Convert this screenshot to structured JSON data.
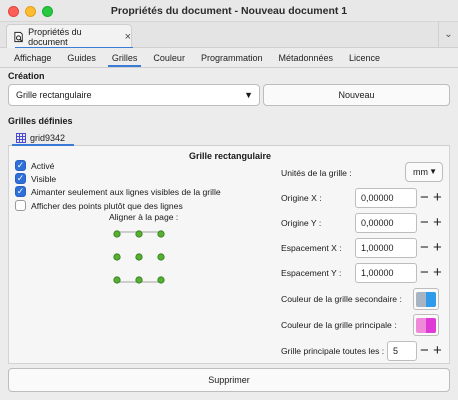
{
  "window": {
    "title": "Propriétés du document - Nouveau document 1"
  },
  "doc_tab": {
    "label": "Propriétés du document",
    "close": "×"
  },
  "tabs": [
    "Affichage",
    "Guides",
    "Grilles",
    "Couleur",
    "Programmation",
    "Métadonnées",
    "Licence"
  ],
  "active_tab": "Grilles",
  "creation": {
    "label": "Création",
    "grid_type": "Grille rectangulaire",
    "new_button": "Nouveau"
  },
  "defined": {
    "label": "Grilles définies",
    "grid_name": "grid9342"
  },
  "panel": {
    "title": "Grille rectangulaire",
    "checks": [
      {
        "label": "Activé",
        "checked": true
      },
      {
        "label": "Visible",
        "checked": true
      },
      {
        "label": "Aimanter seulement aux lignes visibles de la grille",
        "checked": true
      },
      {
        "label": "Afficher des points plutôt que des lignes",
        "checked": false
      }
    ],
    "align_label": "Aligner à la page :",
    "units_label": "Unités de la grille :",
    "units_value": "mm",
    "origin_x_label": "Origine X :",
    "origin_x": "0,00000",
    "origin_y_label": "Origine Y :",
    "origin_y": "0,00000",
    "spacing_x_label": "Espacement X :",
    "spacing_x": "1,00000",
    "spacing_y_label": "Espacement Y :",
    "spacing_y": "1,00000",
    "minor_color_label": "Couleur de la grille secondaire :",
    "major_color_label": "Couleur de la grille principale :",
    "major_every_label": "Grille principale toutes les :",
    "major_every": "5",
    "minor_colors": [
      "#a9b4c2",
      "#2f9bea"
    ],
    "major_colors": [
      "#ef8ad8",
      "#e03ad6"
    ]
  },
  "delete_button": "Supprimer",
  "colors": {
    "accent": "#3a7bd5",
    "checkbox": "#2f6fd9",
    "align_dot": "#55b032"
  }
}
